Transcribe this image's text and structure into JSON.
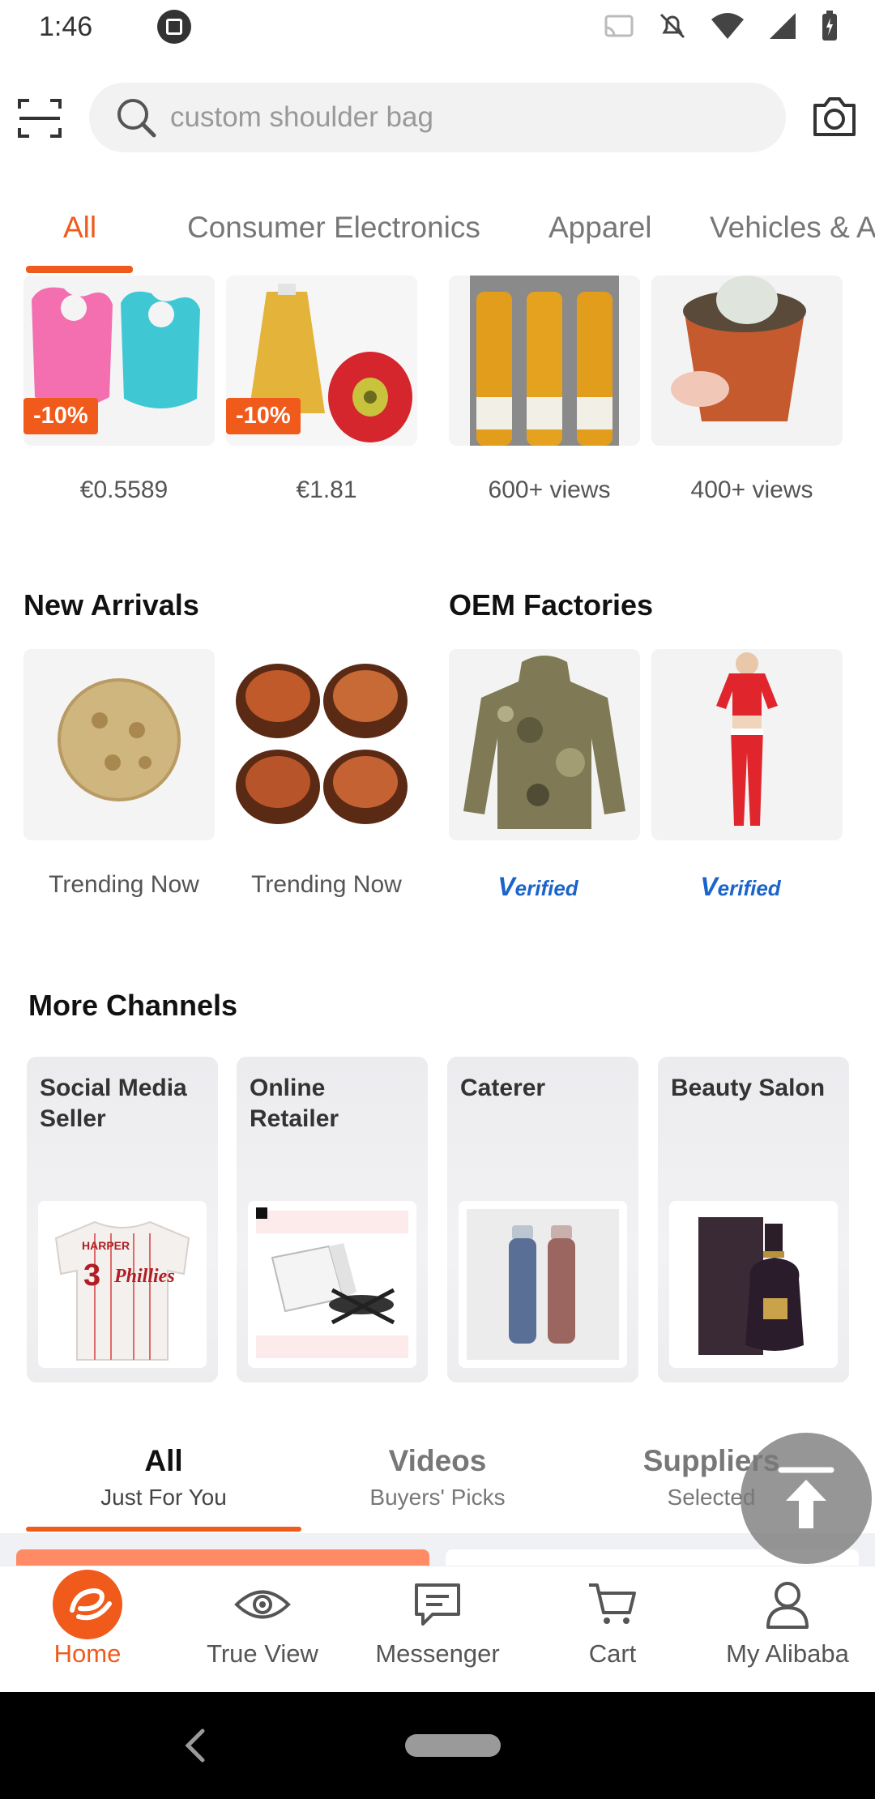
{
  "status_bar": {
    "time": "1:46"
  },
  "search": {
    "placeholder": "custom shoulder bag"
  },
  "category_tabs": [
    "All",
    "Consumer Electronics",
    "Apparel",
    "Vehicles & A"
  ],
  "top_products": [
    {
      "badge": "-10%",
      "label": "€0.5589"
    },
    {
      "badge": "-10%",
      "label": "€1.81"
    },
    {
      "badge": "",
      "label": "600+ views"
    },
    {
      "badge": "",
      "label": "400+ views"
    }
  ],
  "new_arrivals": {
    "title": "New Arrivals",
    "items": [
      {
        "caption": "Trending Now"
      },
      {
        "caption": "Trending Now"
      }
    ]
  },
  "oem_factories": {
    "title": "OEM Factories",
    "items": [
      {
        "caption": "erified"
      },
      {
        "caption": "erified"
      }
    ],
    "verified_mark": "V"
  },
  "more_channels": {
    "title": "More Channels",
    "items": [
      {
        "title": "Social Media Seller"
      },
      {
        "title": "Online Retailer"
      },
      {
        "title": "Caterer"
      },
      {
        "title": "Beauty Salon"
      }
    ]
  },
  "jersey_text": {
    "name": "HARPER",
    "number": "3",
    "team": "Phillies"
  },
  "feed_tabs": [
    {
      "title": "All",
      "subtitle": "Just For You"
    },
    {
      "title": "Videos",
      "subtitle": "Buyers' Picks"
    },
    {
      "title": "Suppliers",
      "subtitle": "Selected"
    }
  ],
  "bottom_nav": [
    {
      "label": "Home",
      "icon": "alibaba-logo-icon"
    },
    {
      "label": "True View",
      "icon": "eye-icon"
    },
    {
      "label": "Messenger",
      "icon": "message-icon"
    },
    {
      "label": "Cart",
      "icon": "cart-icon"
    },
    {
      "label": "My Alibaba",
      "icon": "user-icon"
    }
  ],
  "colors": {
    "accent": "#f05a1a",
    "verified": "#1b64c9"
  }
}
